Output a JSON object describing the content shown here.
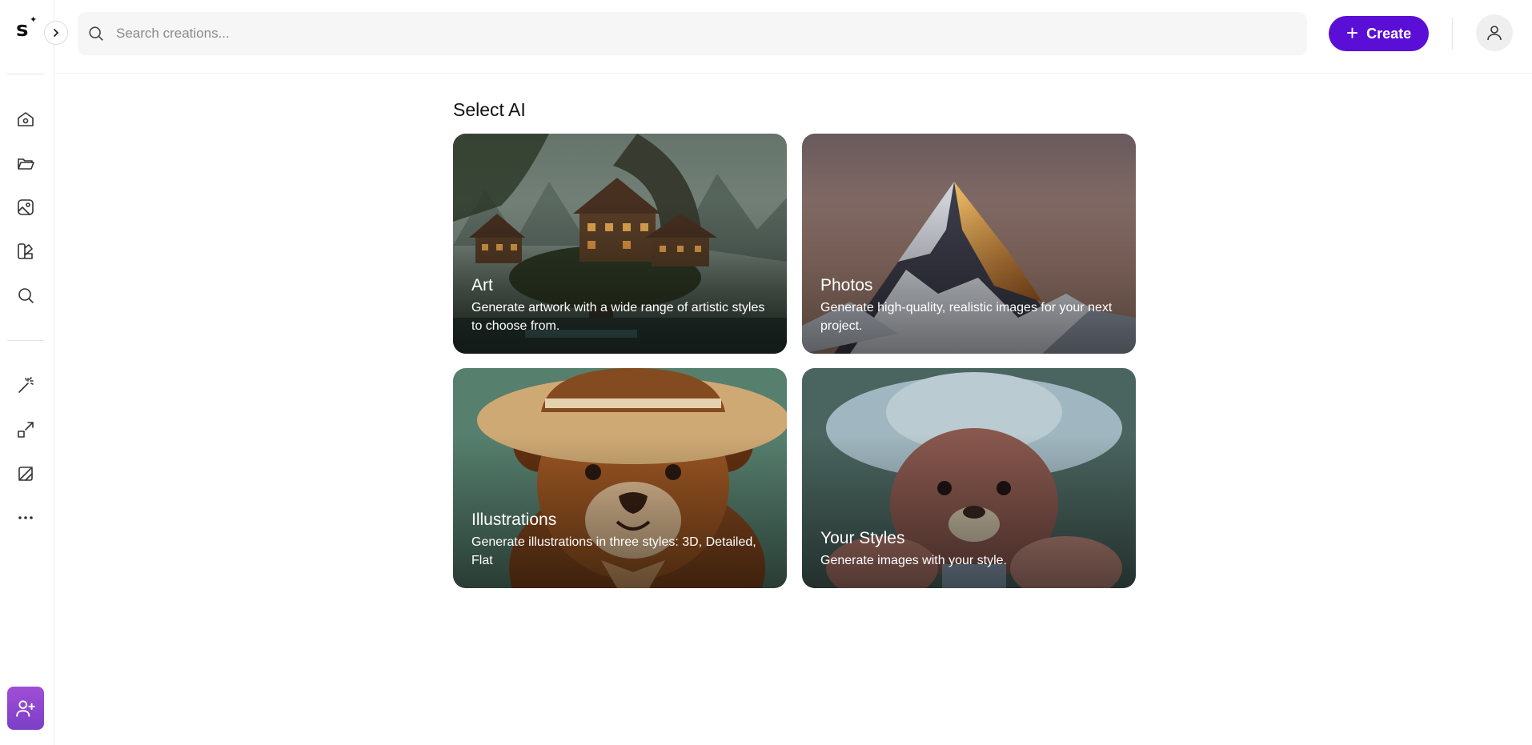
{
  "app": {
    "logo_letter": "s",
    "logo_sparkle": "✦"
  },
  "sidebar": {
    "items": [
      {
        "name": "home",
        "icon": "home-icon"
      },
      {
        "name": "folders",
        "icon": "folder-icon"
      },
      {
        "name": "gallery",
        "icon": "image-icon"
      },
      {
        "name": "styles",
        "icon": "palette-icon"
      },
      {
        "name": "explore",
        "icon": "search-icon"
      },
      {
        "name": "magic",
        "icon": "magic-wand-icon"
      },
      {
        "name": "upscale",
        "icon": "expand-icon"
      },
      {
        "name": "edit",
        "icon": "edit-image-icon"
      },
      {
        "name": "more",
        "icon": "more-icon"
      }
    ],
    "invite_icon": "add-user-icon"
  },
  "header": {
    "search_placeholder": "Search creations...",
    "create_label": "Create",
    "create_plus": "+",
    "accent_color": "#5b0fd6"
  },
  "main": {
    "section_title": "Select AI",
    "cards": [
      {
        "title": "Art",
        "description": "Generate artwork with a wide range of artistic styles to choose from."
      },
      {
        "title": "Photos",
        "description": "Generate high-quality, realistic images for your next project."
      },
      {
        "title": "Illustrations",
        "description": "Generate illustrations in three styles: 3D, Detailed, Flat"
      },
      {
        "title": "Your Styles",
        "description": "Generate images with your style."
      }
    ]
  }
}
